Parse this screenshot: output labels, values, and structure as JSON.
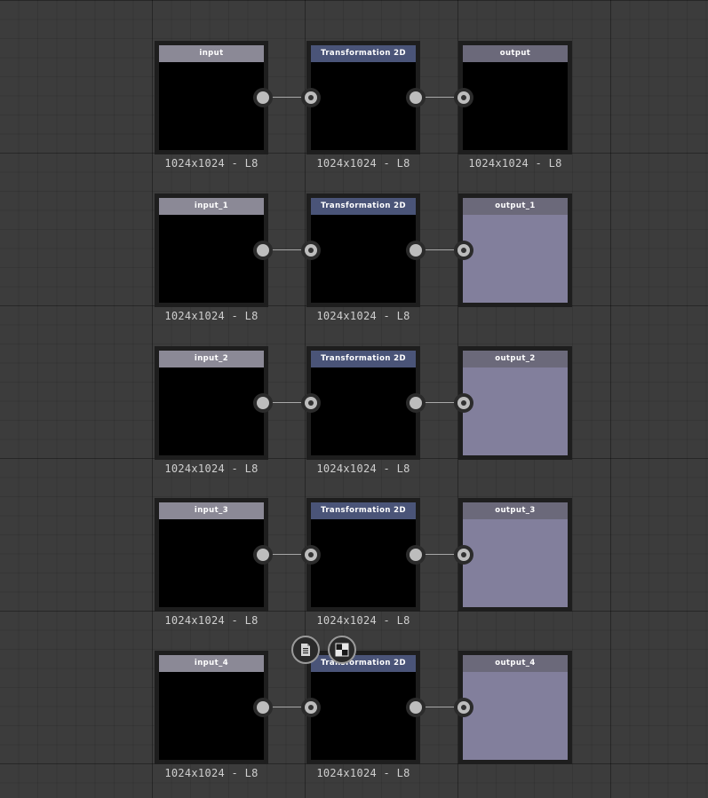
{
  "graph": {
    "rows": [
      {
        "input_title": "input",
        "transform_title": "Transformation 2D",
        "output_title": "output",
        "input_info": "1024x1024 - L8",
        "transform_info": "1024x1024 - L8",
        "output_info": "1024x1024 - L8"
      },
      {
        "input_title": "input_1",
        "transform_title": "Transformation 2D",
        "output_title": "output_1",
        "input_info": "1024x1024 - L8",
        "transform_info": "1024x1024 - L8",
        "output_info": ""
      },
      {
        "input_title": "input_2",
        "transform_title": "Transformation 2D",
        "output_title": "output_2",
        "input_info": "1024x1024 - L8",
        "transform_info": "1024x1024 - L8",
        "output_info": ""
      },
      {
        "input_title": "input_3",
        "transform_title": "Transformation 2D",
        "output_title": "output_3",
        "input_info": "1024x1024 - L8",
        "transform_info": "1024x1024 - L8",
        "output_info": ""
      },
      {
        "input_title": "input_4",
        "transform_title": "Transformation 2D",
        "output_title": "output_4",
        "input_info": "1024x1024 - L8",
        "transform_info": "1024x1024 - L8",
        "output_info": ""
      }
    ]
  },
  "toolbar": {
    "icons": [
      "document-icon",
      "checker-icon"
    ]
  },
  "colors": {
    "background": "#3c3c3c",
    "input_header": "#8b8996",
    "transform_header": "#4a5478",
    "output_header": "#6b697a",
    "output_preview": "#827f9c"
  }
}
